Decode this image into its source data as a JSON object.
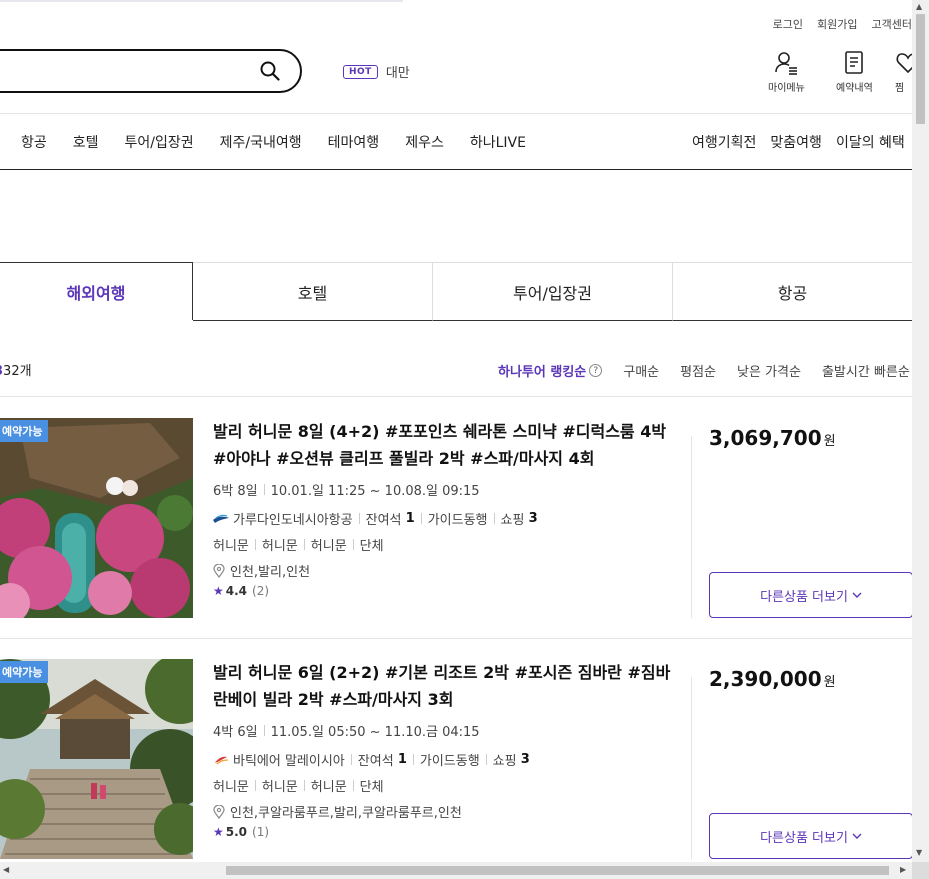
{
  "util_links": [
    "로그인",
    "회원가입",
    "고객센터"
  ],
  "search": {
    "placeholder": ""
  },
  "hot": {
    "badge": "HOT",
    "keyword": "대만"
  },
  "quick": {
    "mymenu": "마이메뉴",
    "reservations": "예약내역",
    "wish": "찜"
  },
  "gnb": {
    "left": [
      "항공",
      "호텔",
      "투어/입장권",
      "제주/국내여행",
      "테마여행",
      "제우스",
      "하나LIVE"
    ],
    "right": [
      "여행기획전",
      "맞춤여행",
      "이달의 혜택"
    ]
  },
  "tabs": [
    "해외여행",
    "호텔",
    "투어/입장권",
    "항공"
  ],
  "result": {
    "count_label": "32개"
  },
  "sort": {
    "ranking": "하나투어 랭킹순",
    "help": "?",
    "options": [
      "구매순",
      "평점순",
      "낮은 가격순",
      "출발시간 빠른순"
    ]
  },
  "colors": {
    "accent": "#5b36b8",
    "badge": "#4a90e2"
  },
  "products": [
    {
      "badge": "예약가능",
      "title": "발리 허니문 8일 (4+2) #포포인츠 쉐라톤 스미냑 #디럭스룸 4박 #아야나 #오션뷰 클리프 풀빌라 2박 #스파/마사지 4회",
      "nights": "6박 8일",
      "schedule": "10.01.일 11:25 ~ 10.08.일 09:15",
      "airline": "가루다인도네시아항공",
      "seats_label": "잔여석",
      "seats": "1",
      "guide": "가이드동행",
      "shopping_label": "쇼핑",
      "shopping": "3",
      "tags": [
        "허니문",
        "허니문",
        "허니문",
        "단체"
      ],
      "route": "인천,발리,인천",
      "rating": "4.4",
      "reviews": "(2)",
      "price": "3,069,700",
      "currency": "원",
      "more": "다른상품 더보기"
    },
    {
      "badge": "예약가능",
      "title": "발리 허니문 6일 (2+2) #기본 리조트 2박 #포시즌 짐바란 #짐바란베이 빌라 2박 #스파/마사지 3회",
      "nights": "4박 6일",
      "schedule": "11.05.일 05:50 ~ 11.10.금 04:15",
      "airline": "바틱에어 말레이시아",
      "seats_label": "잔여석",
      "seats": "1",
      "guide": "가이드동행",
      "shopping_label": "쇼핑",
      "shopping": "3",
      "tags": [
        "허니문",
        "허니문",
        "허니문",
        "단체"
      ],
      "route": "인천,쿠알라룸푸르,발리,쿠알라룸푸르,인천",
      "rating": "5.0",
      "reviews": "(1)",
      "price": "2,390,000",
      "currency": "원",
      "more": "다른상품 더보기"
    }
  ]
}
